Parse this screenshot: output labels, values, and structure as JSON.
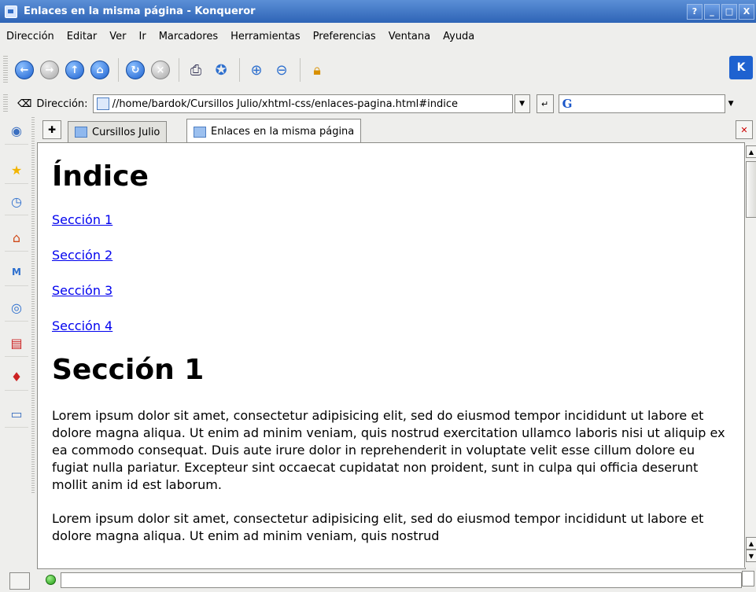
{
  "window": {
    "title": "Enlaces en la misma página - Konqueror",
    "buttons": [
      "?",
      "_",
      "□",
      "X"
    ]
  },
  "menu": [
    "Dirección",
    "Editar",
    "Ver",
    "Ir",
    "Marcadores",
    "Herramientas",
    "Preferencias",
    "Ventana",
    "Ayuda"
  ],
  "toolbar": {
    "icons": [
      "back-icon",
      "forward-icon",
      "up-icon",
      "home-icon",
      "reload-icon",
      "stop-icon",
      "print-icon",
      "security-icon",
      "zoom-in-icon",
      "zoom-out-icon",
      "lock-icon"
    ],
    "logo": "K"
  },
  "address": {
    "label": "Dirección:",
    "value": "//home/bardok/Cursillos Julio/xhtml-css/enlaces-pagina.html#indice"
  },
  "search": {
    "engine": "G"
  },
  "sidebar": {
    "icons": [
      "konqueror-icon",
      "bookmarks-icon",
      "history-icon",
      "home-icon",
      "media-icon",
      "network-icon",
      "folder-icon",
      "services-icon",
      "desktop-icon"
    ]
  },
  "tabs": [
    {
      "label": "Cursillos Julio",
      "active": false
    },
    {
      "label": "Enlaces en la misma página",
      "active": true
    }
  ],
  "page": {
    "heading": "Índice",
    "links": [
      "Sección 1",
      "Sección 2",
      "Sección 3",
      "Sección 4"
    ],
    "section_heading": "Sección 1",
    "paragraph1": "Lorem ipsum dolor sit amet, consectetur adipisicing elit, sed do eiusmod tempor incididunt ut labore et dolore magna aliqua. Ut enim ad minim veniam, quis nostrud exercitation ullamco laboris nisi ut aliquip ex ea commodo consequat. Duis aute irure dolor in reprehenderit in voluptate velit esse cillum dolore eu fugiat nulla pariatur. Excepteur sint occaecat cupidatat non proident, sunt in culpa qui officia deserunt mollit anim id est laborum.",
    "paragraph2": "Lorem ipsum dolor sit amet, consectetur adipisicing elit, sed do eiusmod tempor incididunt ut labore et dolore magna aliqua. Ut enim ad minim veniam, quis nostrud"
  },
  "status": {
    "text": ""
  }
}
